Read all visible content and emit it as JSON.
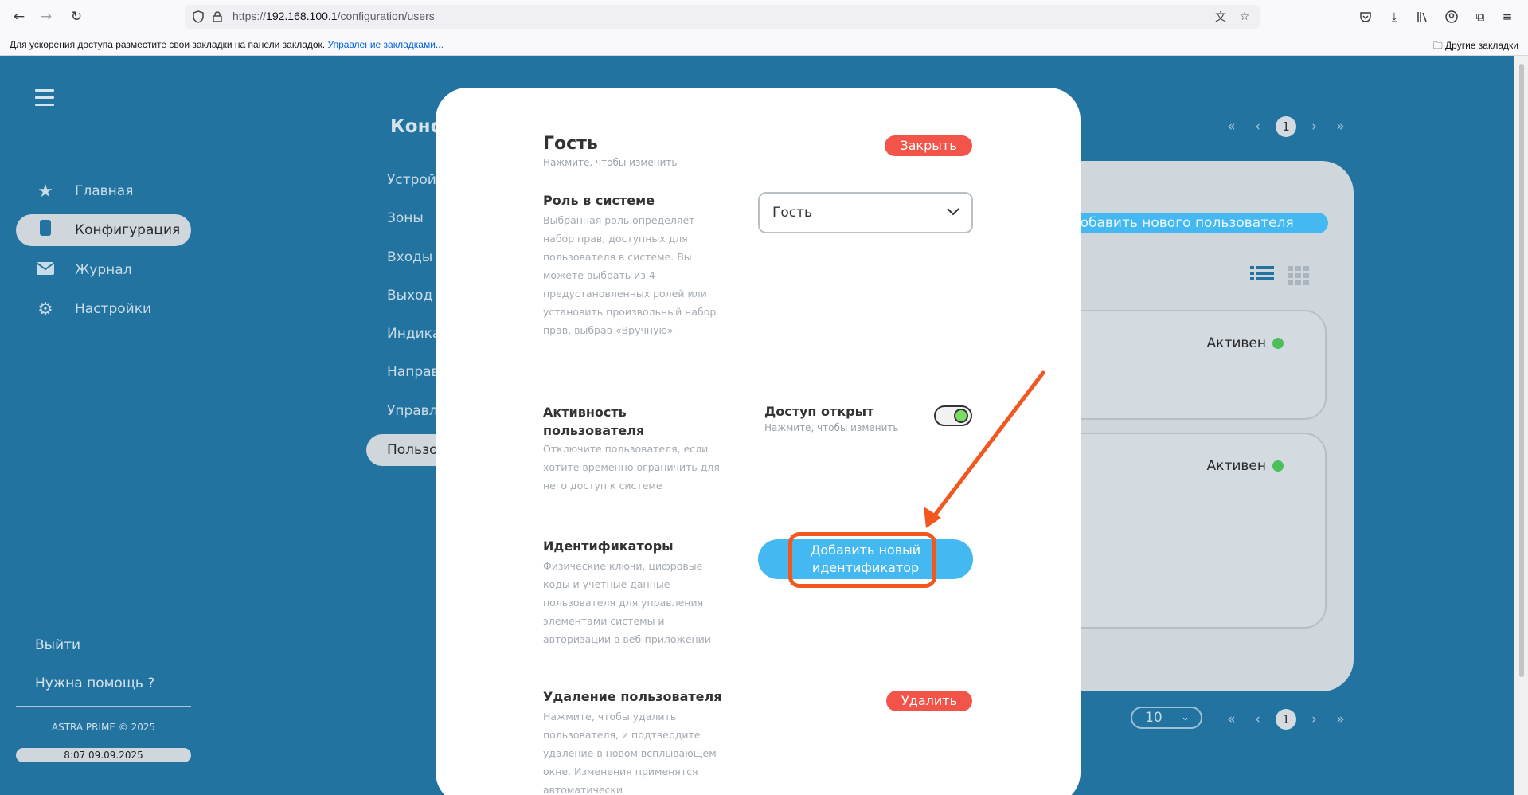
{
  "browser": {
    "url_prefix": "https://",
    "url_host": "192.168.100.1",
    "url_path": "/configuration/users",
    "bookmarks_hint": "Для ускорения доступа разместите свои закладки на панели закладок.",
    "bookmarks_manage": "Управление закладками...",
    "other_bookmarks": "Другие закладки"
  },
  "sidebar": {
    "items": [
      {
        "label": "Главная",
        "icon": "star-icon"
      },
      {
        "label": "Конфигурация",
        "icon": "config-icon"
      },
      {
        "label": "Журнал",
        "icon": "mail-icon"
      },
      {
        "label": "Настройки",
        "icon": "gear-icon"
      }
    ],
    "logout": "Выйти",
    "help": "Нужна помощь ?",
    "copyright": "ASTRA PRIME © 2025",
    "clock": "8:07 09.09.2025"
  },
  "config": {
    "title": "Конф",
    "items": [
      "Устрой",
      "Зоны",
      "Входы",
      "Выход",
      "Индика",
      "Направ",
      "Управл"
    ],
    "active_item": "Пользо"
  },
  "pager": {
    "first": "«",
    "prev": "‹",
    "current": "1",
    "next": "›",
    "last": "»",
    "per_page": "10"
  },
  "users_panel": {
    "add_user": "Добавить нового пользователя",
    "cards": [
      {
        "status": "Активен"
      },
      {
        "status": "Активен"
      }
    ]
  },
  "modal": {
    "title": "Гость",
    "title_hint": "Нажмите, чтобы изменить",
    "close": "Закрыть",
    "role": {
      "title": "Роль в системе",
      "desc": "Выбранная роль определяет набор прав, доступных для пользователя в системе. Вы можете выбрать из 4 предустановленных ролей или установить произвольный набор прав, выбрав «Вручную»",
      "value": "Гость"
    },
    "activity": {
      "title": "Активность пользователя",
      "desc": "Отключите пользователя, если хотите временно ограничить для него доступ к системе",
      "access_title": "Доступ открыт",
      "access_hint": "Нажмите, чтобы изменить",
      "enabled": true
    },
    "identifiers": {
      "title": "Идентификаторы",
      "desc": "Физические ключи, цифровые коды и учетные данные пользователя для управления элементами системы и авторизации в веб-приложении",
      "add_button": "Добавить новый идентификатор"
    },
    "delete": {
      "title": "Удаление пользователя",
      "desc": "Нажмите, чтобы удалить пользователя, и подтвердите удаление в новом всплывающем окне. Изменения применятся автоматически",
      "button": "Удалить"
    }
  },
  "colors": {
    "background": "#2373a0",
    "accent_blue": "#44b8f0",
    "danger_red": "#f25449",
    "active_green": "#4cbf5a",
    "annotation_orange": "#f2571f"
  }
}
